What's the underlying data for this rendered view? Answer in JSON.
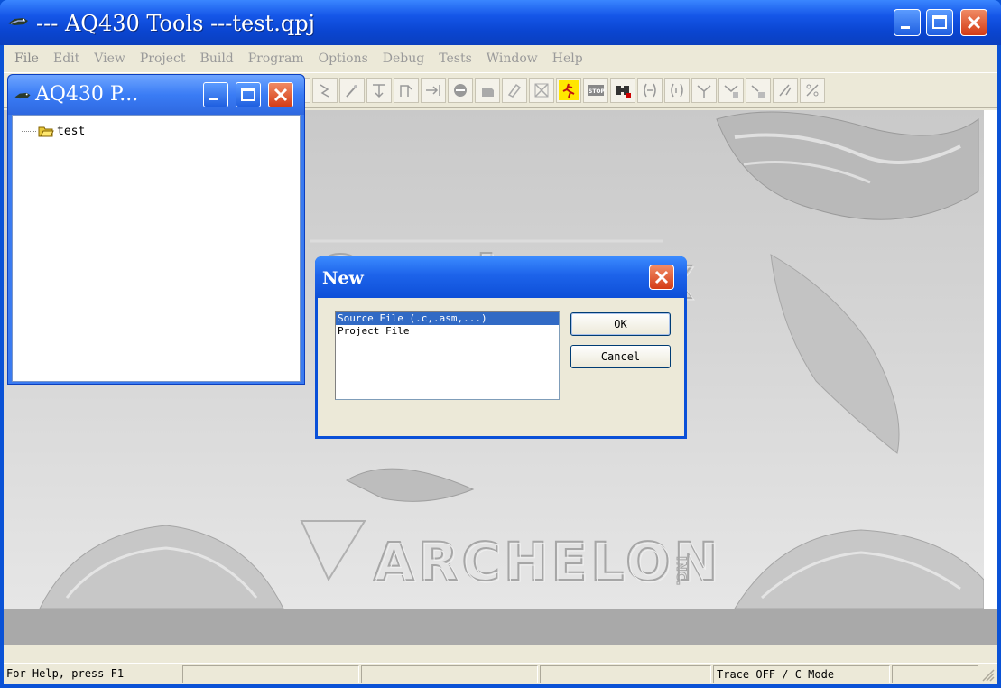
{
  "app": {
    "title": "--- AQ430 Tools ---test.qpj"
  },
  "menu": [
    "File",
    "Edit",
    "View",
    "Project",
    "Build",
    "Program",
    "Options",
    "Debug",
    "Tests",
    "Window",
    "Help"
  ],
  "project_window": {
    "title": "AQ430 P...",
    "tree_item": "test"
  },
  "dialog": {
    "title": "New",
    "list_items": [
      "Source File (.c,.asm,...)",
      "Project File"
    ],
    "selected_index": 0,
    "ok_label": "OK",
    "cancel_label": "Cancel"
  },
  "status": {
    "help": "For Help, press F1",
    "mode": "Trace OFF / C Mode"
  },
  "background_logos": [
    "Quadravox",
    "ARCHELON INC."
  ],
  "colors": {
    "xp_title_blue": "#0a50d8",
    "close_red": "#d43c16",
    "face": "#ece9d8",
    "selection": "#316ac5"
  }
}
